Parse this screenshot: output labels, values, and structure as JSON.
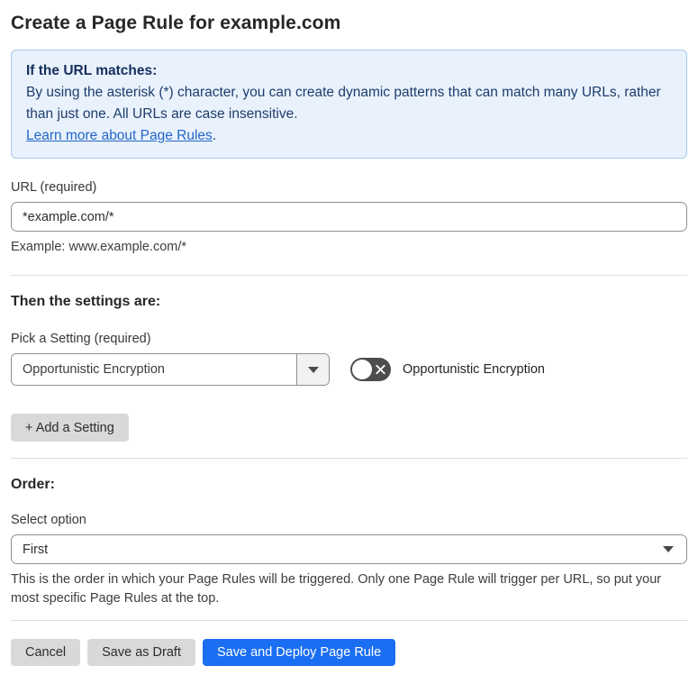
{
  "page": {
    "title": "Create a Page Rule for example.com"
  },
  "info_box": {
    "heading": "If the URL matches:",
    "body": "By using the asterisk (*) character, you can create dynamic patterns that can match many URLs, rather than just one. All URLs are case insensitive.",
    "link_label": "Learn more about Page Rules",
    "link_suffix": "."
  },
  "url_section": {
    "label": "URL (required)",
    "value": "*example.com/*",
    "helper": "Example: www.example.com/*"
  },
  "settings_section": {
    "heading": "Then the settings are:",
    "picker_label": "Pick a Setting (required)",
    "picker_value": "Opportunistic Encryption",
    "toggle_label": "Opportunistic Encryption",
    "toggle_state": "off",
    "add_button_label": "+ Add a Setting"
  },
  "order_section": {
    "heading": "Order:",
    "select_label": "Select option",
    "select_value": "First",
    "helper": "This is the order in which your Page Rules will be triggered. Only one Page Rule will trigger per URL, so put your most specific Page Rules at the top."
  },
  "footer": {
    "cancel_label": "Cancel",
    "save_draft_label": "Save as Draft",
    "save_deploy_label": "Save and Deploy Page Rule"
  },
  "colors": {
    "info_background": "#e9f2fc",
    "info_border": "#aac9ec",
    "info_text": "#1e3c6d",
    "link": "#2365c8",
    "primary_button": "#1a6ef2",
    "gray_button": "#d9d9d9",
    "toggle_off": "#4d4d4d"
  }
}
